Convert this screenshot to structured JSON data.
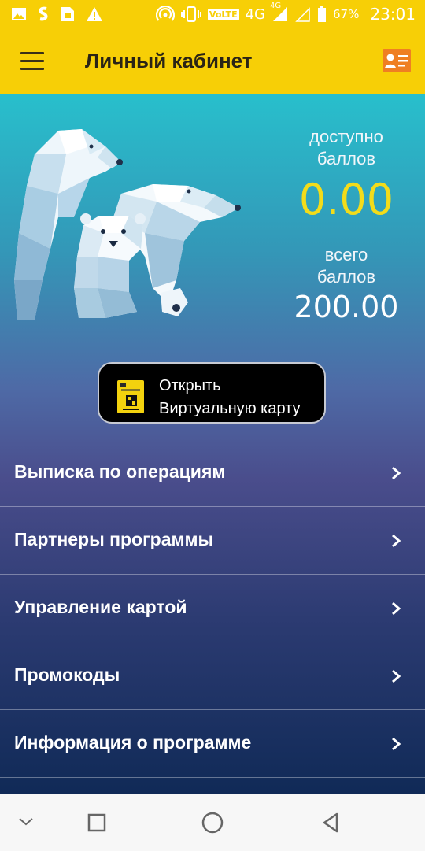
{
  "status_bar": {
    "left_icons": [
      "image-icon",
      "dollar-app-icon",
      "sd-card-icon",
      "warning-icon"
    ],
    "right_icons": [
      "hotspot-icon",
      "vibrate-icon",
      "signal-icon",
      "battery-icon"
    ],
    "volte": "VoLTE",
    "network": "4G",
    "network_small": "4G",
    "battery": "67%",
    "time": "23:01"
  },
  "app_bar": {
    "title": "Личный кабинет",
    "menu_icon": "hamburger-menu-icon",
    "profile_icon": "id-card-icon"
  },
  "balance": {
    "available_label_line1": "доступно",
    "available_label_line2": "баллов",
    "available_value": "0.00",
    "total_label_line1": "всего",
    "total_label_line2": "баллов",
    "total_value": "200.00"
  },
  "virtual_card": {
    "line1": "Открыть",
    "line2": "Виртуальную карту"
  },
  "menu": [
    {
      "label": "Выписка по операциям"
    },
    {
      "label": "Партнеры программы"
    },
    {
      "label": "Управление картой"
    },
    {
      "label": "Промокоды"
    },
    {
      "label": "Информация о программе"
    }
  ],
  "nav_bar": {
    "icons": [
      "nav-hide-icon",
      "recents-icon",
      "home-icon",
      "back-icon"
    ]
  },
  "colors": {
    "brand_yellow": "#f7cf06",
    "available_value": "#f3dc1a"
  }
}
